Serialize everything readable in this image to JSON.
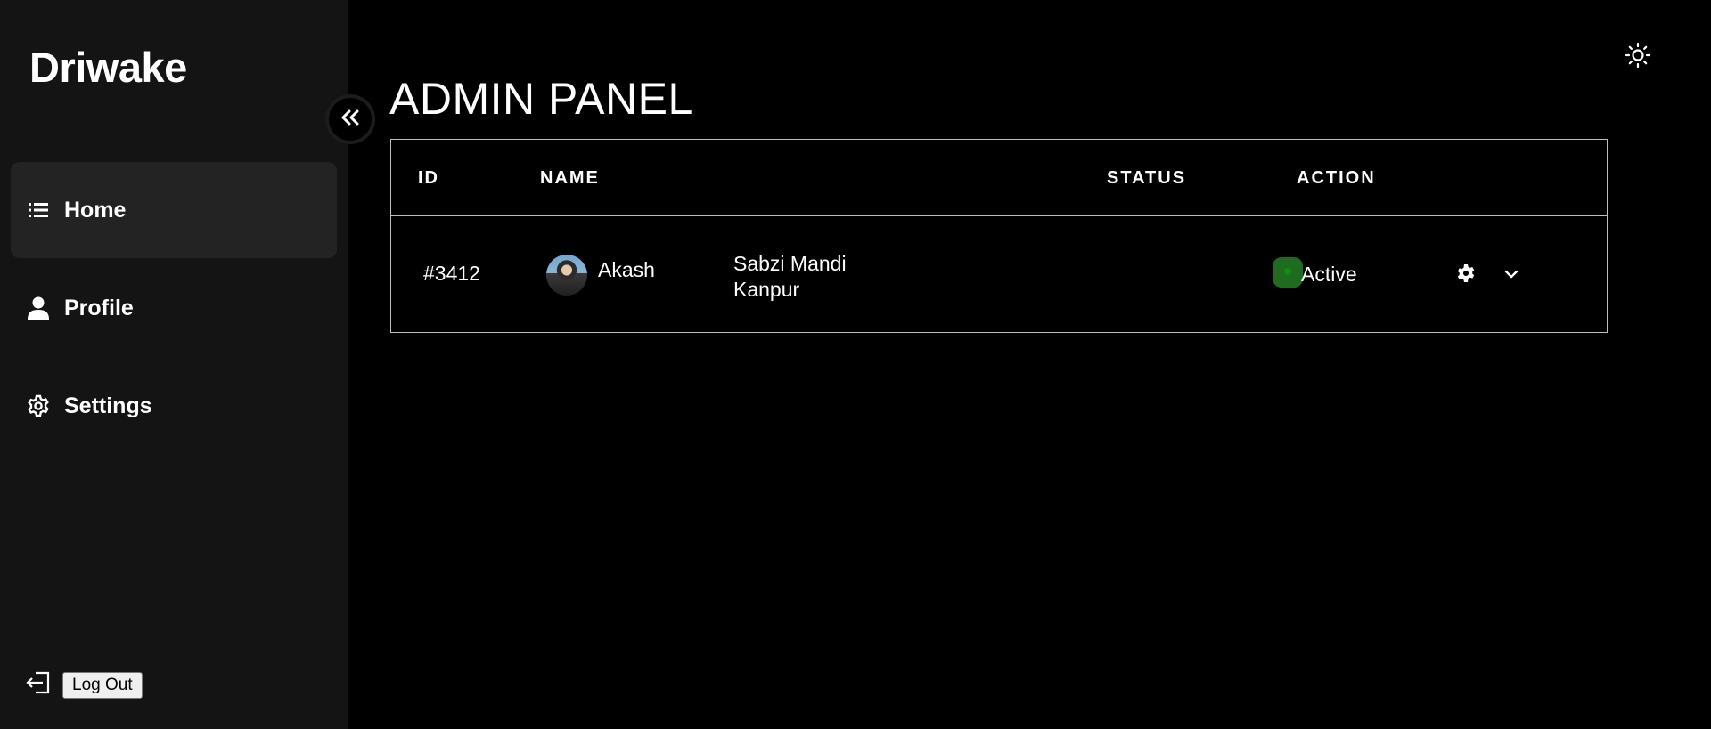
{
  "app": {
    "brand": "Driwake"
  },
  "sidebar": {
    "items": [
      {
        "label": "Home",
        "icon": "list-icon",
        "active": true
      },
      {
        "label": "Profile",
        "icon": "user-icon",
        "active": false
      },
      {
        "label": "Settings",
        "icon": "gear-icon",
        "active": false
      }
    ],
    "logout_label": "Log Out"
  },
  "main": {
    "title": "ADMIN PANEL",
    "table": {
      "headers": [
        "ID",
        "NAME",
        "STATUS",
        "ACTION"
      ],
      "rows": [
        {
          "id": "#3412",
          "name": "Akash",
          "address_line1": "Sabzi Mandi",
          "address_line2": "Kanpur",
          "status": "Active"
        }
      ]
    }
  },
  "colors": {
    "background": "#000000",
    "sidebar": "#141414",
    "active_item": "#232323",
    "status_active": "#1f6b1f",
    "border": "#bdbdbd"
  }
}
